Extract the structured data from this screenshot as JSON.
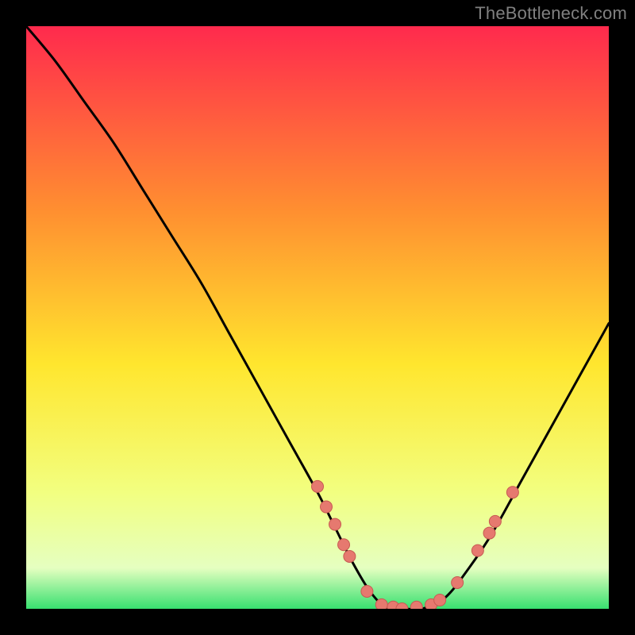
{
  "watermark": "TheBottleneck.com",
  "colors": {
    "background": "#000000",
    "gradient_top": "#FF2A4D",
    "gradient_mid_upper": "#FF9030",
    "gradient_mid": "#FFE62E",
    "gradient_lower": "#F2FF80",
    "gradient_base": "#E5FFC0",
    "gradient_bottom": "#38E070",
    "curve": "#000000",
    "dot_fill": "#E6796F",
    "dot_stroke": "#C75A52"
  },
  "chart_data": {
    "type": "line",
    "title": "",
    "xlabel": "",
    "ylabel": "",
    "xlim": [
      0,
      100
    ],
    "ylim": [
      0,
      100
    ],
    "series": [
      {
        "name": "bottleneck-curve",
        "x": [
          0,
          5,
          10,
          15,
          20,
          25,
          30,
          35,
          40,
          45,
          50,
          53,
          56,
          59,
          62,
          65,
          68,
          72,
          76,
          80,
          85,
          90,
          95,
          100
        ],
        "y": [
          100,
          94,
          87,
          80,
          72,
          64,
          56,
          47,
          38,
          29,
          20,
          14,
          8,
          3,
          0,
          0,
          0,
          2,
          7,
          13,
          22,
          31,
          40,
          49
        ]
      }
    ],
    "points": [
      {
        "x": 50.0,
        "y": 21.0
      },
      {
        "x": 51.5,
        "y": 17.5
      },
      {
        "x": 53.0,
        "y": 14.5
      },
      {
        "x": 54.5,
        "y": 11.0
      },
      {
        "x": 55.5,
        "y": 9.0
      },
      {
        "x": 58.5,
        "y": 3.0
      },
      {
        "x": 61.0,
        "y": 0.7
      },
      {
        "x": 63.0,
        "y": 0.3
      },
      {
        "x": 64.5,
        "y": 0.0
      },
      {
        "x": 67.0,
        "y": 0.3
      },
      {
        "x": 69.5,
        "y": 0.7
      },
      {
        "x": 71.0,
        "y": 1.5
      },
      {
        "x": 74.0,
        "y": 4.5
      },
      {
        "x": 77.5,
        "y": 10.0
      },
      {
        "x": 79.5,
        "y": 13.0
      },
      {
        "x": 80.5,
        "y": 15.0
      },
      {
        "x": 83.5,
        "y": 20.0
      }
    ]
  }
}
